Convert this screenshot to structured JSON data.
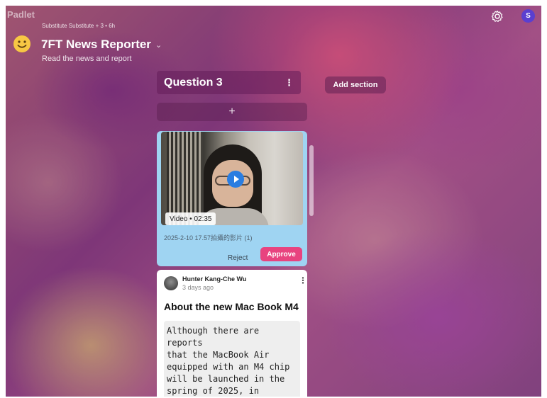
{
  "app": {
    "logo": "Padlet"
  },
  "header": {
    "meta": "Substitute Substitute + 3 • 6h",
    "title": "7FT News Reporter",
    "chevron": "⌄",
    "description": "Read the news and report",
    "avatar_initial": "S"
  },
  "section": {
    "title": "Question 3",
    "more": "⋮",
    "add_post": "+",
    "add_section_label": "Add section"
  },
  "video_post": {
    "badge": "Video • 02:35",
    "caption": "2025-2-10 17.57拍攝的影片 (1)",
    "reject_label": "Reject",
    "approve_label": "Approve"
  },
  "text_post": {
    "author": "Hunter Kang-Che Wu",
    "time": "3 days ago",
    "more": "⋮",
    "title": "About the new Mac Book M4",
    "body": "Although there are reports\nthat the MacBook Air\nequipped with an M4 chip\nwill be launched in the\nspring of 2025, in\naddition to the chip\nupgrade, the appearance of the"
  },
  "colors": {
    "approve": "#e8437f",
    "video_card": "#9fd4f2",
    "avatar": "#5a3fd0",
    "play": "#2a7de1"
  },
  "icons": [
    "smiley-icon",
    "gear-icon",
    "more-vertical-icon",
    "plus-icon",
    "play-icon",
    "chevron-down-icon"
  ]
}
